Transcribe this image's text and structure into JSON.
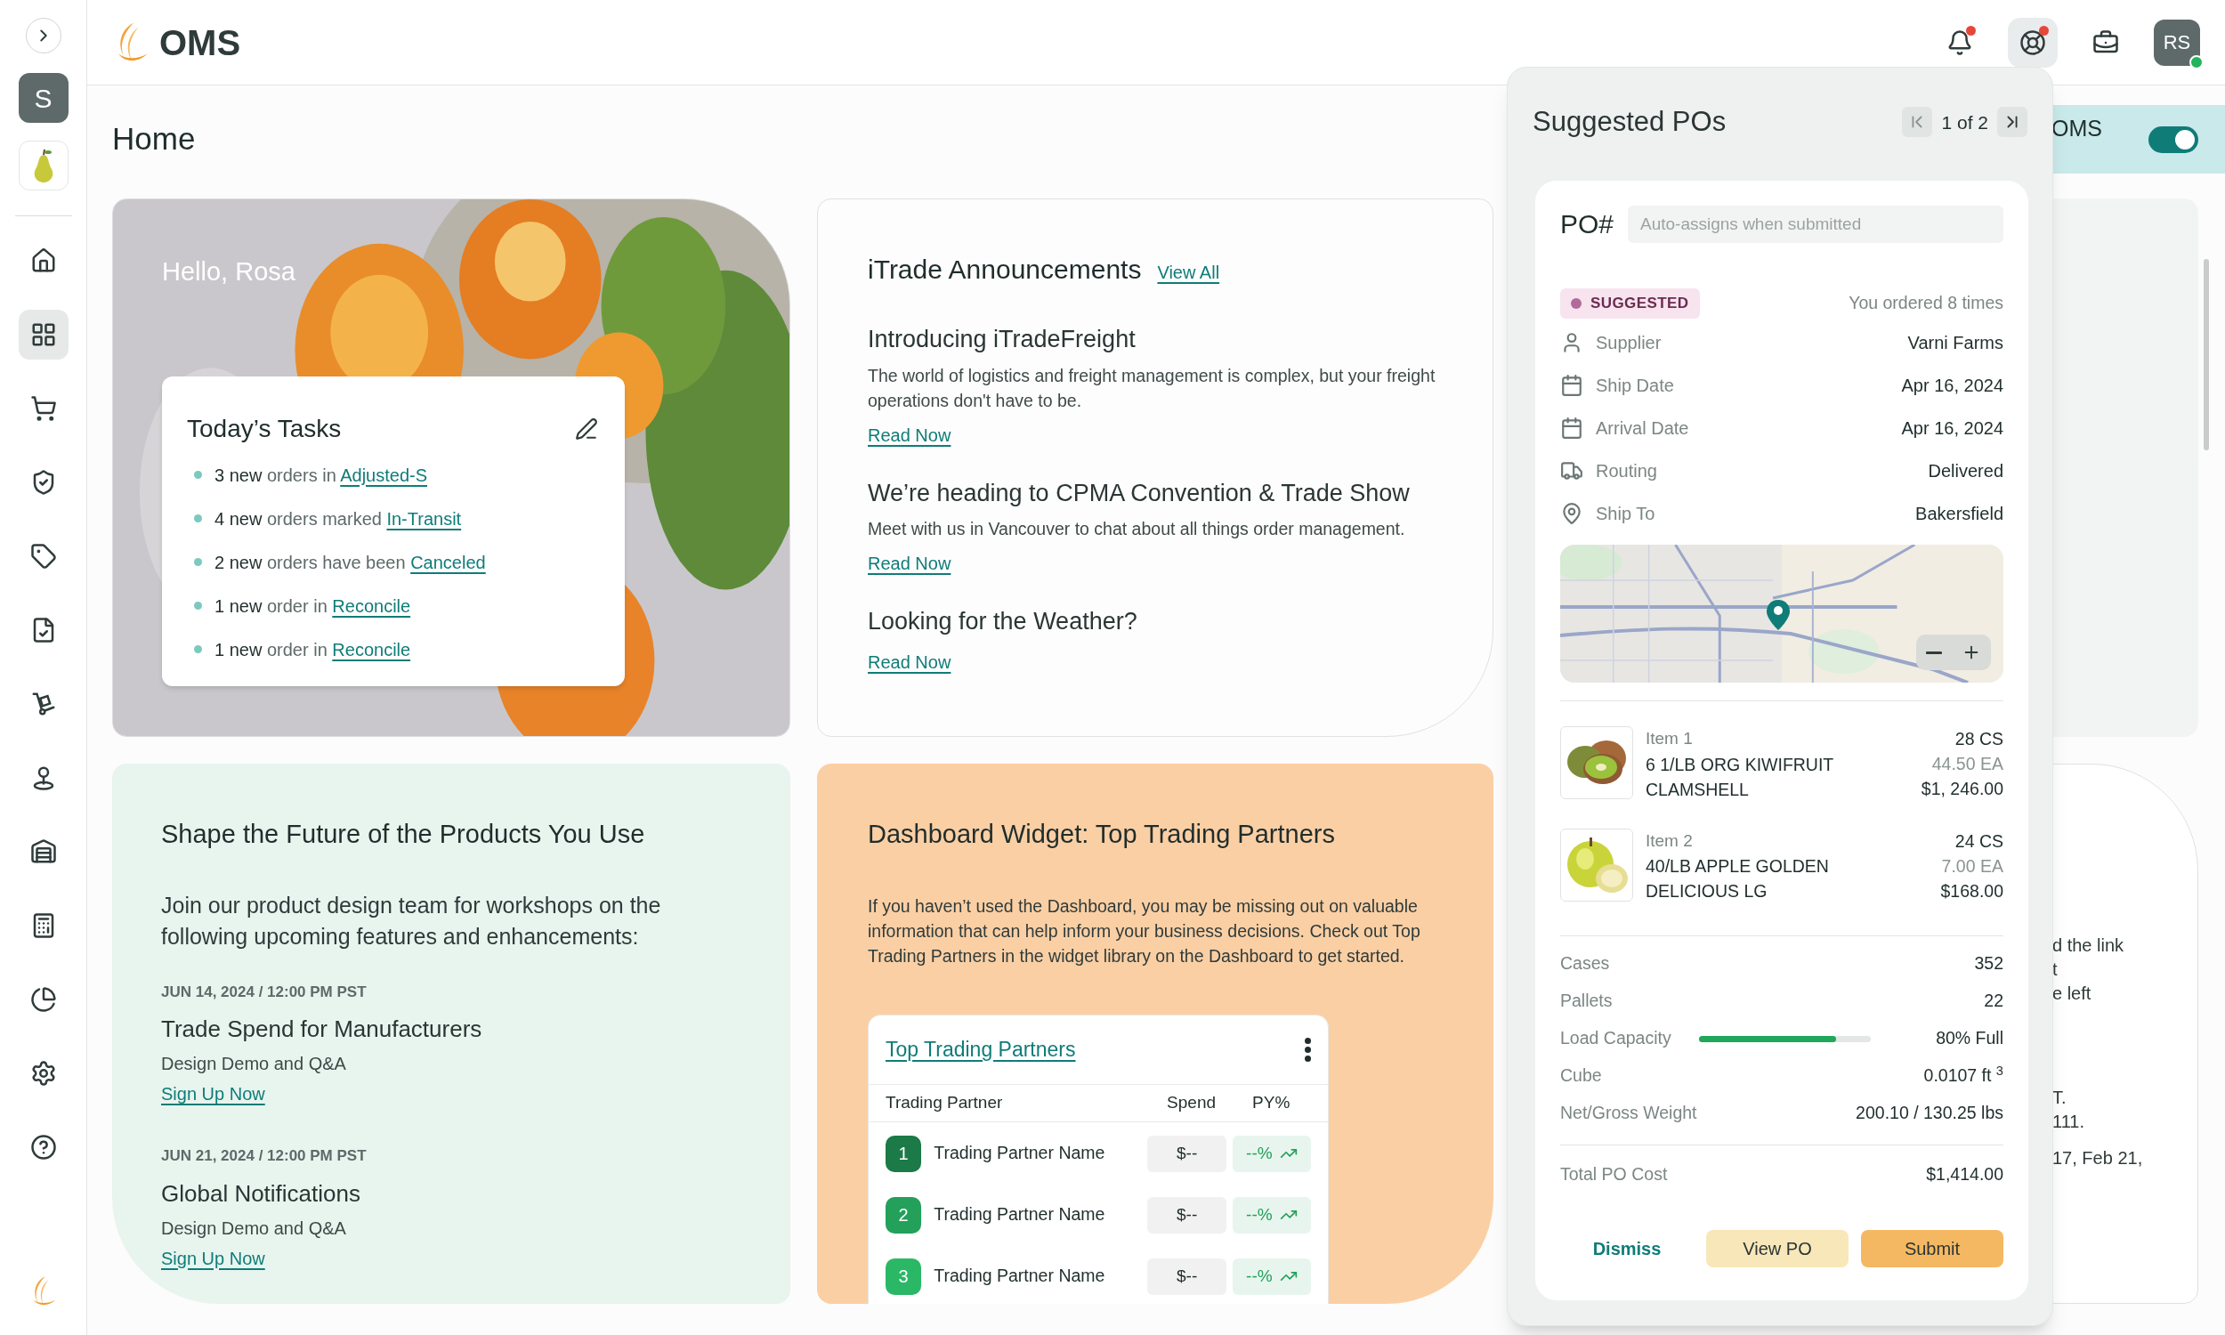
{
  "sidebar": {
    "workspace": "S",
    "items": [
      {
        "selected": false
      },
      {
        "selected": true
      },
      {
        "selected": false
      },
      {
        "selected": false
      },
      {
        "selected": false
      },
      {
        "selected": false
      },
      {
        "selected": false
      },
      {
        "selected": false
      },
      {
        "selected": false
      },
      {
        "selected": false
      },
      {
        "selected": false
      },
      {
        "selected": false
      },
      {
        "selected": false
      }
    ]
  },
  "header": {
    "logo": "OMS",
    "icons": [
      {
        "alert": true,
        "selected": false
      },
      {
        "alert": true,
        "selected": true
      },
      {
        "alert": false,
        "selected": false
      }
    ],
    "avatar": {
      "initials": "RS",
      "online": true
    }
  },
  "page_title": "Home",
  "banner": {
    "text": "OMS",
    "toggle_on": true
  },
  "hello": {
    "greeting": "Hello, Rosa",
    "tasks_title": "Today’s Tasks",
    "tasks": [
      {
        "count": "3 new",
        "text": "orders in",
        "link": "Adjusted-S"
      },
      {
        "count": "4 new",
        "text": "orders marked",
        "link": "In-Transit"
      },
      {
        "count": "2 new",
        "text": "orders have been",
        "link": "Canceled"
      },
      {
        "count": "1 new",
        "text": "order in",
        "link": "Reconcile"
      },
      {
        "count": "1 new",
        "text": "order in",
        "link": "Reconcile"
      }
    ]
  },
  "announcements": {
    "title": "iTrade Announcements",
    "view_all": "View All",
    "items": [
      {
        "title": "Introducing iTradeFreight",
        "body": "The world of logistics and freight management is complex, but your freight operations don't have to be.",
        "link": "Read Now"
      },
      {
        "title": "We’re heading to CPMA Convention & Trade Show",
        "body": "Meet with us in Vancouver to chat about all things order management.",
        "link": "Read Now"
      },
      {
        "title": "Looking for the Weather?",
        "link": "Read Now"
      }
    ]
  },
  "shape": {
    "title": "Shape the Future of the Products You Use",
    "intro": "Join our product design team for workshops on the following upcoming features and enhancements:",
    "events": [
      {
        "date": "JUN 14, 2024 / 12:00 PM PST",
        "title": "Trade Spend for Manufacturers",
        "subtitle": "Design Demo and Q&A",
        "link": "Sign Up Now"
      },
      {
        "date": "JUN 21, 2024 / 12:00 PM PST",
        "title": "Global Notifications",
        "subtitle": "Design Demo and Q&A",
        "link": "Sign Up Now"
      }
    ]
  },
  "dashboard": {
    "title": "Dashboard Widget: Top Trading Partners",
    "body": "If you haven’t used the Dashboard, you may be missing out on valuable information that can help inform your business decisions. Check out Top Trading Partners in the widget library on the Dashboard to get started.",
    "widget": {
      "title": "Top Trading Partners",
      "columns": [
        "Trading Partner",
        "Spend",
        "PY%"
      ],
      "rows": [
        {
          "rank": "1",
          "color": "#1b7a47",
          "name": "Trading Partner Name",
          "spend": "$--",
          "py": "--%"
        },
        {
          "rank": "2",
          "color": "#23a05a",
          "name": "Trading Partner Name",
          "spend": "$--",
          "py": "--%"
        },
        {
          "rank": "3",
          "color": "#2bb866",
          "name": "Trading Partner Name",
          "spend": "$--",
          "py": "--%"
        }
      ]
    }
  },
  "background_card": {
    "lines": [
      "d the link",
      "t",
      "e left",
      "T.",
      "111.",
      "17, Feb 21,"
    ]
  },
  "suggested_pos": {
    "title": "Suggested POs",
    "pager": "1 of 2",
    "po_label": "PO#",
    "po_placeholder": "Auto-assigns when submitted",
    "status": "SUGGESTED",
    "ordered": "You ordered 8 times",
    "details": [
      {
        "kind": "person",
        "label": "Supplier",
        "value": "Varni Farms"
      },
      {
        "kind": "calendar",
        "label": "Ship Date",
        "value": "Apr 16, 2024"
      },
      {
        "kind": "calendar",
        "label": "Arrival Date",
        "value": "Apr 16, 2024"
      },
      {
        "kind": "truck",
        "label": "Routing",
        "value": "Delivered"
      },
      {
        "kind": "pin",
        "label": "Ship To",
        "value": "Bakersfield"
      }
    ],
    "items": [
      {
        "kind": "kiwi",
        "label": "Item 1",
        "name": "6 1/LB ORG KIWIFRUIT CLAMSHELL",
        "qty": "28 CS",
        "each": "44.50 EA",
        "total": "$1, 246.00"
      },
      {
        "kind": "apple",
        "label": "Item 2",
        "name": "40/LB APPLE GOLDEN DELICIOUS LG",
        "qty": "24 CS",
        "each": "7.00 EA",
        "total": "$168.00"
      }
    ],
    "summary": [
      {
        "kind": "text",
        "label": "Cases",
        "value": "352"
      },
      {
        "kind": "text",
        "label": "Pallets",
        "value": "22"
      },
      {
        "kind": "bar",
        "label": "Load Capacity",
        "level": 0.8,
        "value": "80% Full"
      },
      {
        "kind": "text",
        "label": "Cube",
        "value": "0.0107 ft $^{3}$"
      },
      {
        "kind": "text",
        "label": "Net/Gross Weight",
        "value": "200.10 / 130.25 lbs"
      }
    ],
    "total_label": "Total PO Cost",
    "total": "$1,414.00",
    "buttons": [
      "Dismiss",
      "View PO",
      "Submit"
    ]
  }
}
